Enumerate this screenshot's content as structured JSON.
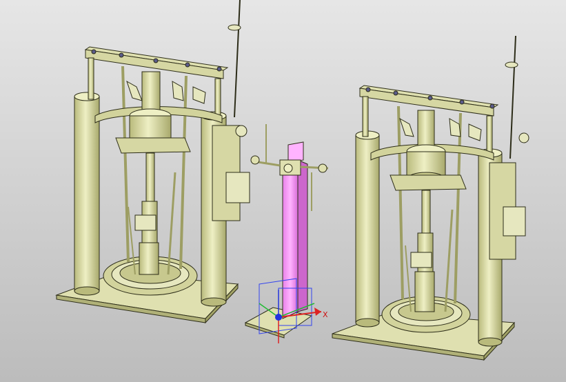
{
  "scene": {
    "background_top": "#e6e6e6",
    "background_bottom": "#bcbcbc",
    "model_color": "#dfe0b0",
    "model_shade": "#c9ca8c",
    "edge_color": "#2c2c18",
    "highlight_color": "#ff99ff",
    "triad": {
      "x_label": "X",
      "x_color": "#dd2222",
      "y_color": "#22bb33",
      "z_color": "#2233dd",
      "plane_color": "#3344ee"
    },
    "parts": [
      {
        "id": "pump-station-left"
      },
      {
        "id": "center-column-selected",
        "selected": true
      },
      {
        "id": "pump-station-right"
      }
    ]
  }
}
